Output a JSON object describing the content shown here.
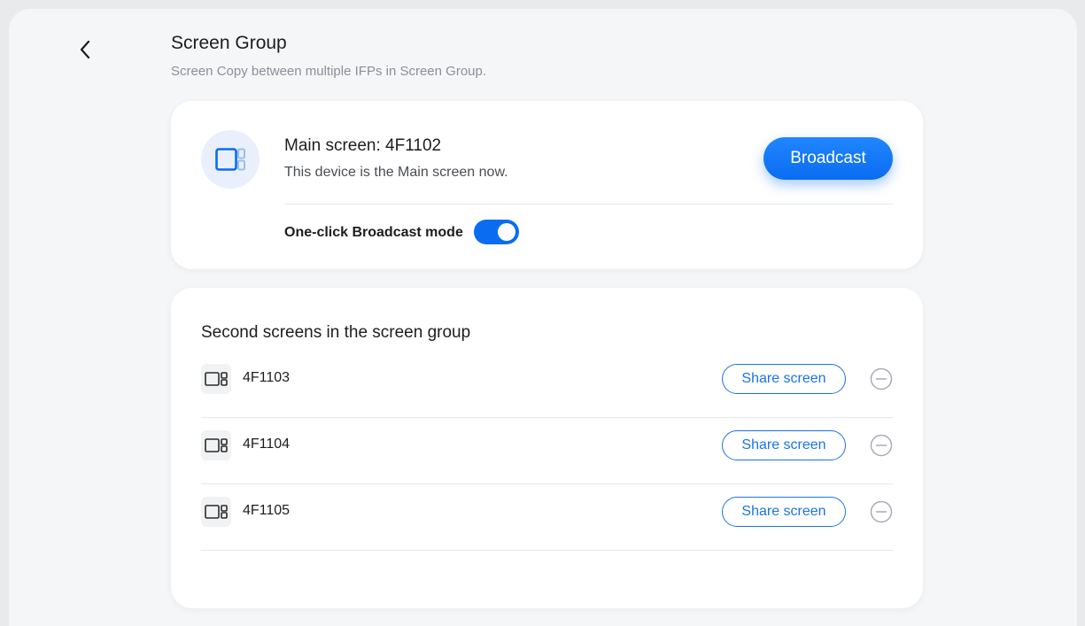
{
  "header": {
    "title": "Screen Group",
    "subtitle": "Screen Copy between multiple IFPs in Screen Group.",
    "back_icon": "chevron-left-icon"
  },
  "main_screen": {
    "name": "Main screen: 4F1102",
    "description": "This device is the Main screen now.",
    "icon": "screen-group-icon",
    "broadcast_label": "Broadcast",
    "toggle_label": "One-click Broadcast mode",
    "toggle_on": true
  },
  "second_screens": {
    "title": "Second screens in the screen group",
    "items": [
      {
        "name": "4F1103",
        "share_label": "Share screen"
      },
      {
        "name": "4F1104",
        "share_label": "Share screen"
      },
      {
        "name": "4F1105",
        "share_label": "Share screen"
      }
    ]
  },
  "colors": {
    "accent": "#0a6cf0",
    "background": "#f5f6f8",
    "card": "#ffffff"
  }
}
